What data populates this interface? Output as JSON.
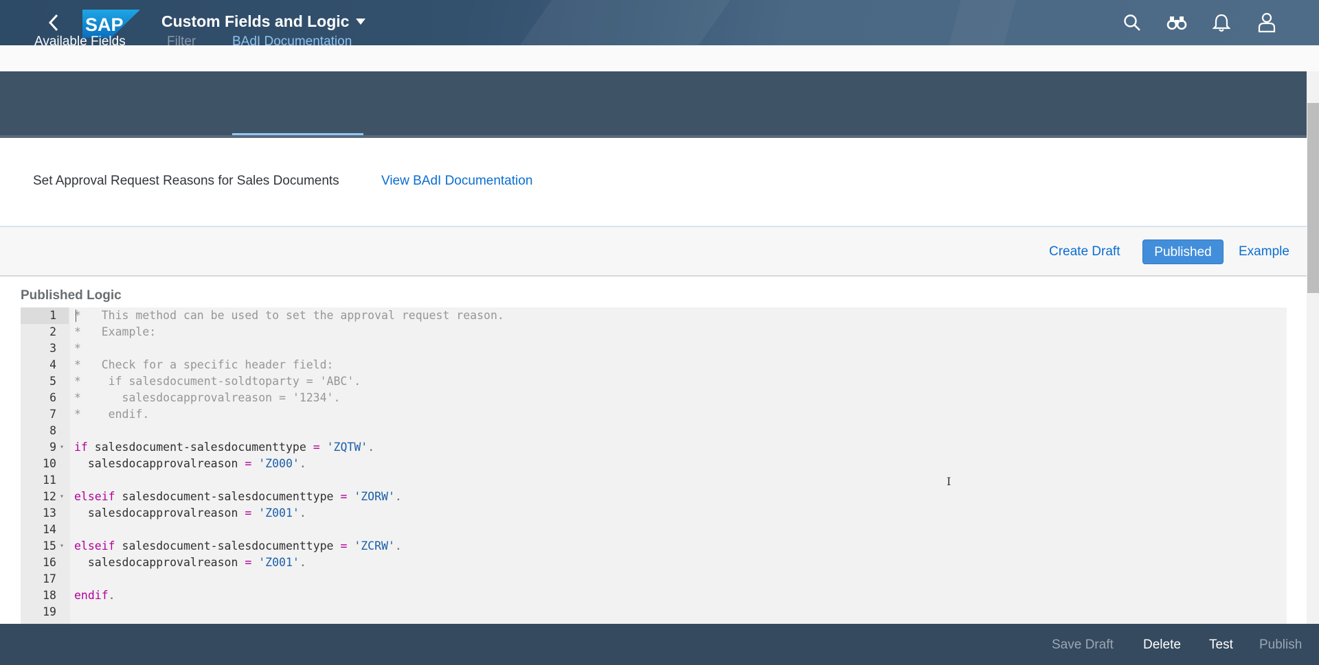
{
  "shell": {
    "app_title": "Custom Fields and Logic",
    "logo_text": "SAP",
    "icons": [
      "back-icon",
      "search-icon",
      "binoculars-icon",
      "bell-icon",
      "user-icon"
    ]
  },
  "tabs": {
    "available_fields": "Available Fields",
    "filter": "Filter",
    "badi_documentation": "BAdI Documentation",
    "selected": "BAdI Documentation"
  },
  "doc": {
    "description": "Set Approval Request Reasons for Sales Documents",
    "link": "View BAdI Documentation"
  },
  "toolbar": {
    "create_draft": "Create Draft",
    "published": "Published",
    "example": "Example"
  },
  "logic": {
    "title": "Published Logic",
    "lines": [
      {
        "n": "1",
        "text": "*   This method can be used to set the approval request reason."
      },
      {
        "n": "2",
        "text": "*   Example:"
      },
      {
        "n": "3",
        "text": "*"
      },
      {
        "n": "4",
        "text": "*   Check for a specific header field:"
      },
      {
        "n": "5",
        "text": "*    if salesdocument-soldtoparty = 'ABC'."
      },
      {
        "n": "6",
        "text": "*      salesdocapprovalreason = '1234'."
      },
      {
        "n": "7",
        "text": "*    endif."
      },
      {
        "n": "8",
        "text": ""
      },
      {
        "n": "9",
        "text": "if salesdocument-salesdocumenttype = 'ZQTW'."
      },
      {
        "n": "10",
        "text": "  salesdocapprovalreason = 'Z000'."
      },
      {
        "n": "11",
        "text": ""
      },
      {
        "n": "12",
        "text": "elseif salesdocument-salesdocumenttype = 'ZORW'."
      },
      {
        "n": "13",
        "text": "  salesdocapprovalreason = 'Z001'."
      },
      {
        "n": "14",
        "text": ""
      },
      {
        "n": "15",
        "text": "elseif salesdocument-salesdocumenttype = 'ZCRW'."
      },
      {
        "n": "16",
        "text": "  salesdocapprovalreason = 'Z001'."
      },
      {
        "n": "17",
        "text": ""
      },
      {
        "n": "18",
        "text": "endif."
      },
      {
        "n": "19",
        "text": ""
      }
    ]
  },
  "footer": {
    "save_draft": "Save Draft",
    "delete": "Delete",
    "test": "Test",
    "publish": "Publish"
  },
  "colors": {
    "shell": "#354a5f",
    "tab_selected": "#91c8f6",
    "link": "#0a6ed1",
    "published_button": "#428eda",
    "keyword": "#b3009a",
    "string": "#1b5fa8",
    "comment": "#969696"
  }
}
